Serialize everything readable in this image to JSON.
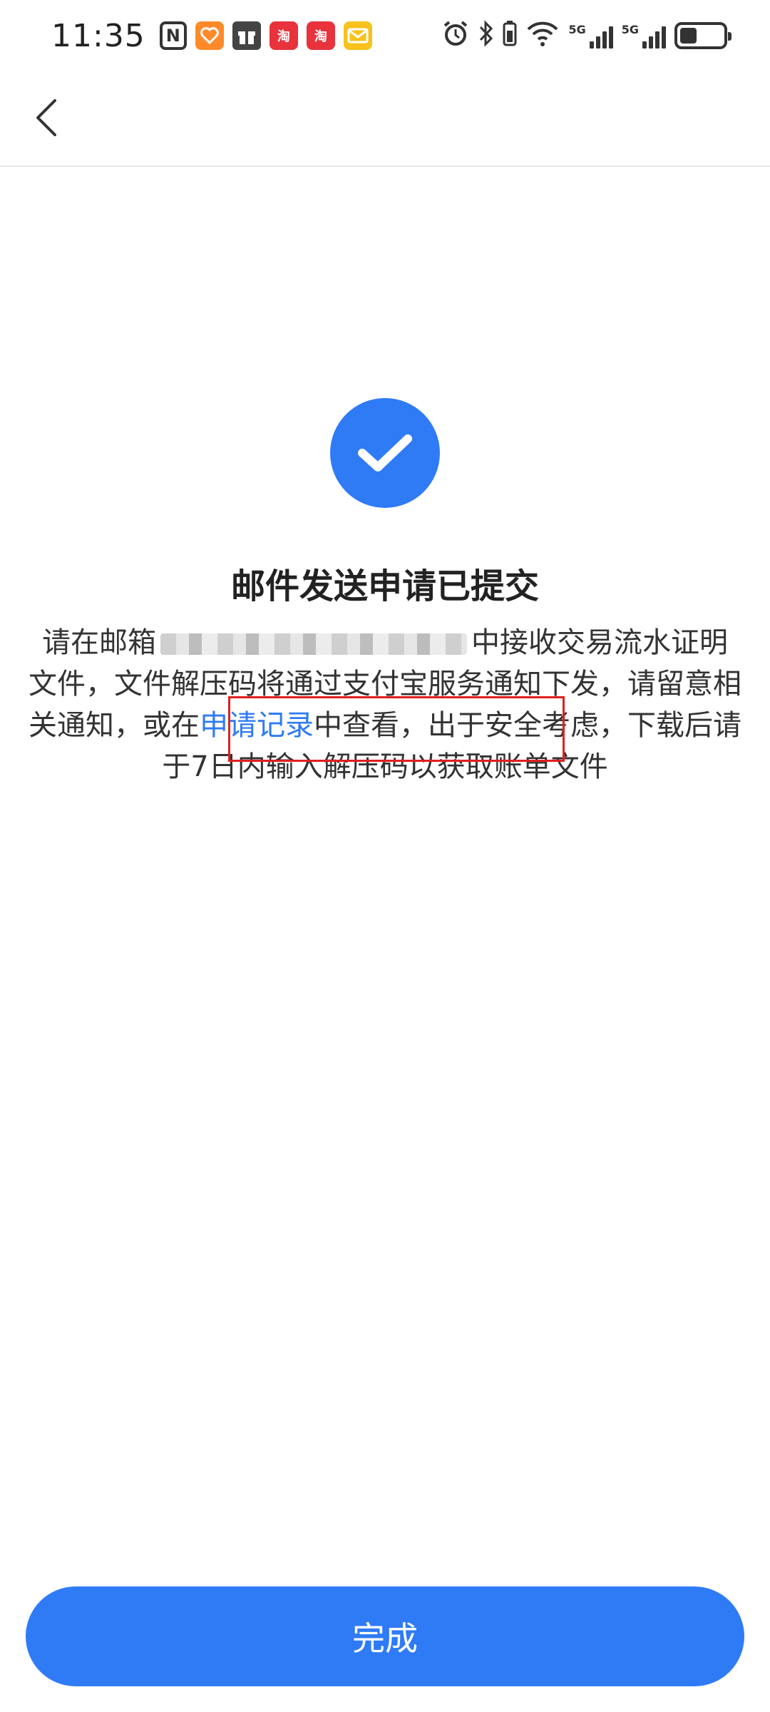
{
  "status_bar": {
    "time": "11:35",
    "icons_left": [
      "nfc-icon",
      "heart-app-icon",
      "gift-app-icon",
      "taobao-icon",
      "taobao-icon",
      "mail-app-icon"
    ],
    "icons_right": [
      "alarm-icon",
      "bluetooth-icon",
      "battery-saver-icon",
      "wifi-icon",
      "signal-5g-icon",
      "signal-5g-icon",
      "battery-icon"
    ],
    "net1_label": "5G",
    "net2_label": "5G",
    "nfc_label": "N",
    "taobao_label": "淘",
    "battery_level": 0.4
  },
  "header": {
    "back_icon": "chevron-left-icon"
  },
  "main": {
    "icon": "check-circle-icon",
    "title": "邮件发送申请已提交",
    "desc_part1": "请在邮箱",
    "desc_part2": "中接收交易流水证明文件，文件解压码将通过支付宝服务通知下发，请留意相关通知，或在",
    "desc_link": "申请记录",
    "desc_part3": "中查看，出于安全考虑，下载后请于7日内输入解压码以获取账单文件"
  },
  "footer": {
    "done_label": "完成"
  },
  "colors": {
    "primary": "#2f7bf6",
    "highlight": "#e02020"
  }
}
